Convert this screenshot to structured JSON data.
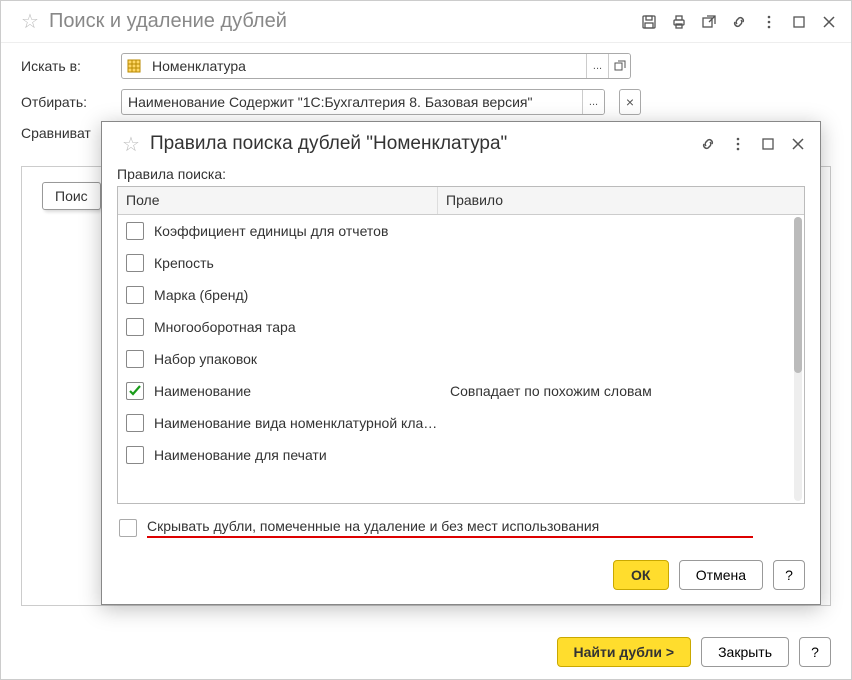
{
  "main": {
    "title": "Поиск и удаление дублей",
    "labels": {
      "search_in": "Искать в:",
      "filter": "Отбирать:",
      "compare": "Сравниват"
    },
    "search_in_value": "Номенклатура",
    "filter_value": "Наименование Содержит \"1С:Бухгалтерия 8. Базовая версия\"",
    "tab_poisk": "Поис",
    "buttons": {
      "find": "Найти дубли >",
      "close": "Закрыть",
      "help": "?"
    },
    "icon_labels": {
      "ellipsis": "...",
      "clear": "×"
    }
  },
  "dialog": {
    "title": "Правила поиска дублей \"Номенклатура\"",
    "rules_label": "Правила поиска:",
    "columns": {
      "field": "Поле",
      "rule": "Правило"
    },
    "rows": [
      {
        "checked": false,
        "field": "Коэффициент единицы для отчетов",
        "rule": ""
      },
      {
        "checked": false,
        "field": "Крепость",
        "rule": ""
      },
      {
        "checked": false,
        "field": "Марка (бренд)",
        "rule": ""
      },
      {
        "checked": false,
        "field": "Многооборотная тара",
        "rule": ""
      },
      {
        "checked": false,
        "field": "Набор упаковок",
        "rule": ""
      },
      {
        "checked": true,
        "field": "Наименование",
        "rule": "Совпадает по похожим словам"
      },
      {
        "checked": false,
        "field": "Наименование вида номенклатурной кла…",
        "rule": ""
      },
      {
        "checked": false,
        "field": "Наименование для печати",
        "rule": ""
      }
    ],
    "hide_duplicates_text": "Скрывать дубли, помеченные на удаление и без мест использования",
    "buttons": {
      "ok": "ОК",
      "cancel": "Отмена",
      "help": "?"
    }
  }
}
